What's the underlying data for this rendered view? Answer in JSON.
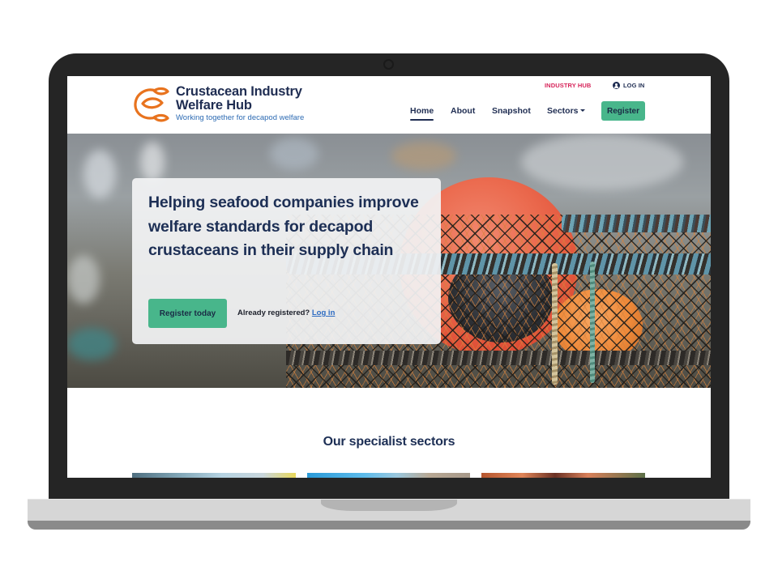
{
  "brand": {
    "name_line1": "Crustacean Industry",
    "name_line2": "Welfare Hub",
    "tagline": "Working together for decapod welfare",
    "colors": {
      "navy": "#1f2d52",
      "orange": "#e8731e",
      "green": "#48b68b",
      "pink": "#d6245a",
      "link_blue": "#2d6bc2"
    }
  },
  "utility_nav": {
    "industry_hub": "INDUSTRY HUB",
    "login": "LOG IN",
    "login_icon": "user-circle-icon"
  },
  "nav": {
    "items": [
      {
        "label": "Home",
        "active": true
      },
      {
        "label": "About"
      },
      {
        "label": "Snapshot"
      },
      {
        "label": "Sectors",
        "has_dropdown": true
      }
    ],
    "register": "Register"
  },
  "hero": {
    "title": "Helping seafood companies improve welfare standards for decapod crustaceans in their supply chain",
    "cta": "Register today",
    "already_registered": "Already registered?",
    "login_link": "Log in"
  },
  "sectors": {
    "title": "Our specialist sectors"
  }
}
